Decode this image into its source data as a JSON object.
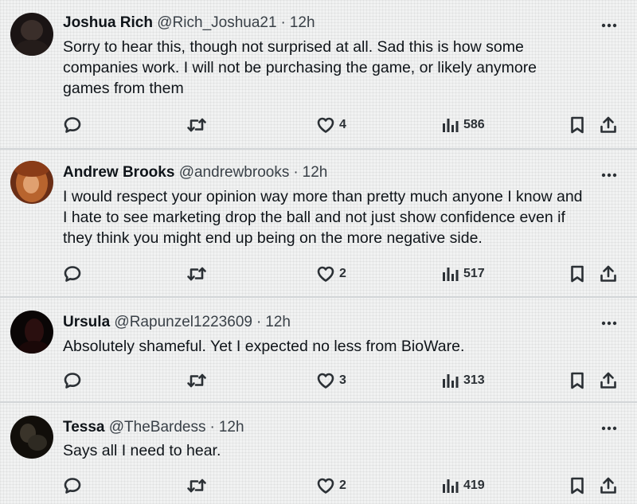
{
  "posts": [
    {
      "name": "Joshua Rich",
      "handle": "@Rich_Joshua21",
      "time": "12h",
      "lines": [
        "Sorry to hear this, though not surprised at all.  Sad this is how some",
        "companies work.  I will not be purchasing the game, or likely anymore",
        "games from them"
      ],
      "likes": "4",
      "views": "586",
      "avatar_colors": [
        "#1a1414",
        "#3a2e2a"
      ]
    },
    {
      "name": "Andrew Brooks",
      "handle": "@andrewbrooks",
      "time": "12h",
      "lines": [
        "I would respect your opinion way more than pretty much anyone I know and",
        "I hate to see marketing drop the ball and not just show confidence even if",
        "they think you might end up being on the more negative side."
      ],
      "likes": "2",
      "views": "517",
      "avatar_colors": [
        "#b8642e",
        "#5a2a14"
      ]
    },
    {
      "name": "Ursula",
      "handle": "@Rapunzel1223609",
      "time": "12h",
      "lines": [
        "Absolutely shameful. Yet I expected no less from BioWare."
      ],
      "likes": "3",
      "views": "313",
      "avatar_colors": [
        "#2a0f0f",
        "#0a0606"
      ]
    },
    {
      "name": "Tessa",
      "handle": "@TheBardess",
      "time": "12h",
      "lines": [
        "Says all I need to hear."
      ],
      "likes": "2",
      "views": "419",
      "avatar_colors": [
        "#2e2a22",
        "#110e0a"
      ]
    }
  ],
  "icons": {
    "reply": "reply-icon",
    "repost": "repost-icon",
    "like": "heart-icon",
    "views": "views-chart-icon",
    "bookmark": "bookmark-icon",
    "share": "share-icon",
    "more": "more-icon"
  },
  "colors": {
    "text": "#0f1419",
    "secondary": "#3a4148",
    "separator": "#d3d6d8",
    "background": "#f1f2f2"
  }
}
